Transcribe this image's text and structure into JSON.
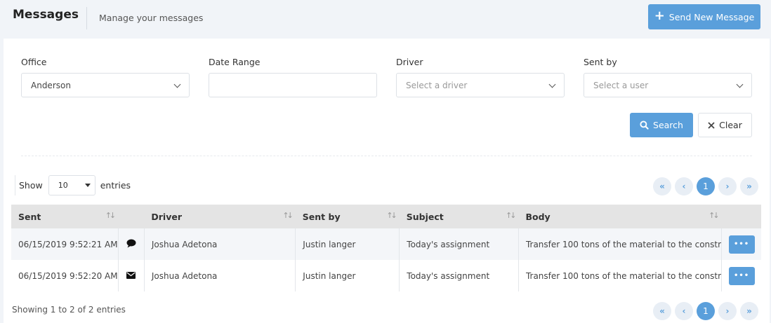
{
  "header": {
    "title": "Messages",
    "subtitle": "Manage your messages",
    "send_label": "Send New Message"
  },
  "filters": {
    "office": {
      "label": "Office",
      "value": "Anderson"
    },
    "date_range": {
      "label": "Date Range",
      "value": ""
    },
    "driver": {
      "label": "Driver",
      "placeholder": "Select a driver"
    },
    "sent_by": {
      "label": "Sent by",
      "placeholder": "Select a user"
    },
    "search_label": "Search",
    "clear_label": "Clear"
  },
  "length": {
    "show": "Show",
    "value": "10",
    "entries": "entries"
  },
  "pagination": {
    "current": "1",
    "first": "«",
    "prev": "‹",
    "next": "›",
    "last": "»"
  },
  "table": {
    "columns": [
      "Sent",
      "Driver",
      "Sent by",
      "Subject",
      "Body"
    ],
    "rows": [
      {
        "sent": "06/15/2019 9:52:21 AM",
        "icon": "chat-bubble-icon",
        "driver": "Joshua Adetona",
        "sent_by": "Justin langer",
        "subject": "Today's assignment",
        "body": "Transfer 100 tons of the material to the constr"
      },
      {
        "sent": "06/15/2019 9:52:20 AM",
        "icon": "envelope-icon",
        "driver": "Joshua Adetona",
        "sent_by": "Justin langer",
        "subject": "Today's assignment",
        "body": "Transfer 100 tons of the material to the constr"
      }
    ],
    "more_label": "•••"
  },
  "info": "Showing 1 to 2 of 2 entries",
  "colors": {
    "accent": "#5a9fdb",
    "header_bg": "#f1f4f8",
    "table_head": "#e4e4e4"
  }
}
